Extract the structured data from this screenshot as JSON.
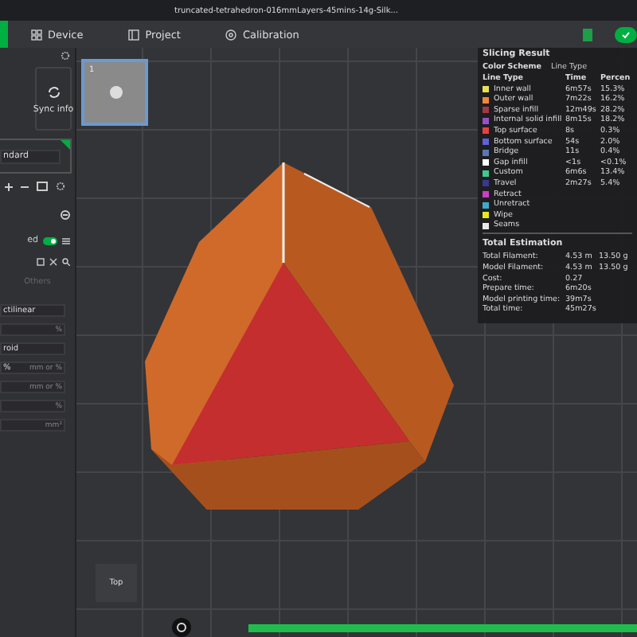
{
  "title": "truncated-tetrahedron-016mmLayers-45mins-14g-Silk...",
  "tabs": [
    {
      "label": "Device",
      "selected": false
    },
    {
      "label": "Project",
      "selected": false
    },
    {
      "label": "Calibration",
      "selected": false
    }
  ],
  "left_panel": {
    "sync_label": "Sync info",
    "preset": "ndard",
    "toggle": {
      "label": "ed",
      "on": true
    },
    "section": "Others",
    "fields": [
      {
        "value": "ctilinear"
      },
      {
        "unit": "%"
      },
      {
        "value": "roid"
      },
      {
        "value": "%",
        "unit": "mm or %"
      },
      {
        "unit": "mm or %"
      },
      {
        "unit": "%"
      },
      {
        "unit": "mm²"
      }
    ]
  },
  "plate": {
    "number": "1"
  },
  "slicing_result": {
    "title": "Slicing Result",
    "scheme_label": "Color Scheme",
    "scheme_value": "Line Type",
    "columns": [
      "Line Type",
      "Time",
      "Percen"
    ],
    "rows": [
      {
        "name": "Inner wall",
        "time": "6m57s",
        "percent": "15.3%",
        "color": "#e8e050"
      },
      {
        "name": "Outer wall",
        "time": "7m22s",
        "percent": "16.2%",
        "color": "#f08838"
      },
      {
        "name": "Sparse infill",
        "time": "12m49s",
        "percent": "28.2%",
        "color": "#a03848"
      },
      {
        "name": "Internal solid infill",
        "time": "8m15s",
        "percent": "18.2%",
        "color": "#9850c8"
      },
      {
        "name": "Top surface",
        "time": "8s",
        "percent": "0.3%",
        "color": "#e84040"
      },
      {
        "name": "Bottom surface",
        "time": "54s",
        "percent": "2.0%",
        "color": "#6060d8"
      },
      {
        "name": "Bridge",
        "time": "11s",
        "percent": "0.4%",
        "color": "#5878b0"
      },
      {
        "name": "Gap infill",
        "time": "<1s",
        "percent": "<0.1%",
        "color": "#ffffff"
      },
      {
        "name": "Custom",
        "time": "6m6s",
        "percent": "13.4%",
        "color": "#40c890"
      },
      {
        "name": "Travel",
        "time": "2m27s",
        "percent": "5.4%",
        "color": "#383890"
      },
      {
        "name": "Retract",
        "color": "#c840c8"
      },
      {
        "name": "Unretract",
        "color": "#40a8c8"
      },
      {
        "name": "Wipe",
        "color": "#e8e820"
      },
      {
        "name": "Seams",
        "color": "#e8e8e8"
      }
    ],
    "estimation_title": "Total Estimation",
    "estimates": [
      {
        "label": "Total Filament:",
        "value": "4.53 m",
        "extra": "13.50 g"
      },
      {
        "label": "Model Filament:",
        "value": "4.53 m",
        "extra": "13.50 g"
      },
      {
        "label": "Cost:",
        "value": "0.27"
      },
      {
        "label": "Prepare time:",
        "value": "6m20s"
      },
      {
        "label": "Model printing time:",
        "value": "39m7s"
      },
      {
        "label": "Total time:",
        "value": "45m27s"
      }
    ]
  },
  "view_label": "Top",
  "progress": {
    "level": 1
  }
}
